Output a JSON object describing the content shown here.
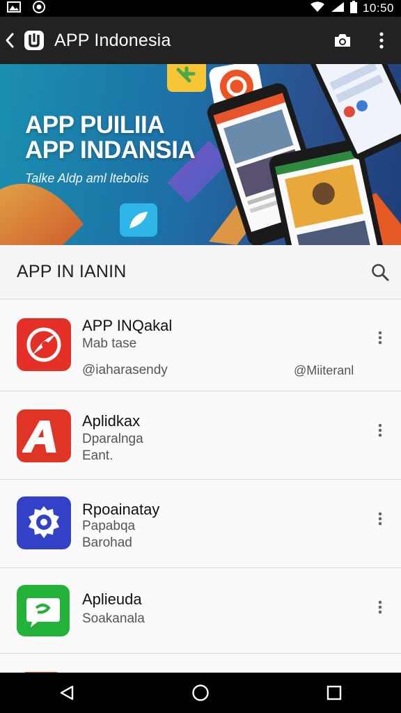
{
  "status_bar": {
    "time": "10:50"
  },
  "app_bar": {
    "title": "APP Indonesia"
  },
  "banner": {
    "line1": "APP PUILIIA",
    "line2": "APP INDANSIA",
    "subtitle": "Talke Aldp aml ltebolis"
  },
  "section": {
    "title": "APP IN IANIN"
  },
  "apps": [
    {
      "name": "APP INQakal",
      "sub": "Mab tase",
      "meta_left": "@iaharasendy",
      "meta_right": "@Miiteranl",
      "icon": "red-disc-icon",
      "color": "#e53027"
    },
    {
      "name": "Aplidkax",
      "sub": "Dparalnga",
      "meta_left": "Eant.",
      "icon": "letter-a-icon",
      "color": "#e03526"
    },
    {
      "name": "Rpoainatay",
      "sub": "Papabqa",
      "meta_left": "Barohad",
      "icon": "eye-gear-icon",
      "color": "#3340c8"
    },
    {
      "name": "Aplieuda",
      "sub": "Soakanala",
      "icon": "chat-bubble-icon",
      "color": "#22b23a"
    }
  ],
  "colors": {
    "status_bar": "#000000",
    "app_bar": "#222222",
    "banner_accent_orange": "#f07a28",
    "banner_accent_green": "#8cc63f"
  }
}
